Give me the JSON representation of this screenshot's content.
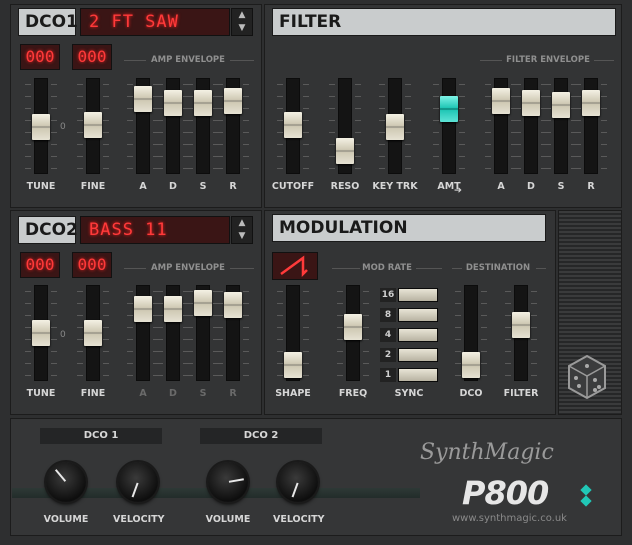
{
  "dco1": {
    "title": "DCO1",
    "patch": "2 FT SAW",
    "num1": "000",
    "num2": "000",
    "amp_env": "AMP ENVELOPE",
    "labels": {
      "tune": "TUNE",
      "fine": "FINE",
      "a": "A",
      "d": "D",
      "s": "S",
      "r": "R"
    },
    "zero": "0"
  },
  "filter": {
    "title": "FILTER",
    "env": "FILTER ENVELOPE",
    "labels": {
      "cutoff": "CUTOFF",
      "reso": "RESO",
      "keytrk": "KEY TRK",
      "amt": "AMT",
      "a": "A",
      "d": "D",
      "s": "S",
      "r": "R"
    },
    "arrow": "➔"
  },
  "dco2": {
    "title": "DCO2",
    "patch": "BASS 11",
    "num1": "000",
    "num2": "000",
    "amp_env": "AMP ENVELOPE",
    "labels": {
      "tune": "TUNE",
      "fine": "FINE",
      "a": "A",
      "d": "D",
      "s": "S",
      "r": "R"
    },
    "zero": "0"
  },
  "modulation": {
    "title": "MODULATION",
    "mod_rate": "MOD RATE",
    "destination": "DESTINATION",
    "labels": {
      "shape": "SHAPE",
      "freq": "FREQ",
      "sync": "SYNC",
      "dco": "DCO",
      "filter": "FILTER"
    },
    "sync_values": [
      "16",
      "8",
      "4",
      "2",
      "1"
    ]
  },
  "mixer": {
    "dco1": "DCO 1",
    "dco2": "DCO 2",
    "volume": "VOLUME",
    "velocity": "VELOCITY"
  },
  "brand": {
    "script": "SynthMagic",
    "model": "P800",
    "url": "www.synthmagic.co.uk"
  },
  "colors": {
    "led": "#ff3a3a",
    "panel": "#333435",
    "accent": "#21c7b6"
  }
}
